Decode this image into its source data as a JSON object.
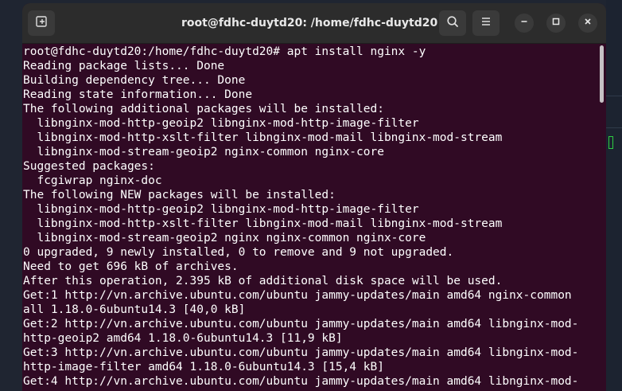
{
  "window": {
    "title": "root@fdhc-duytd20: /home/fdhc-duytd20"
  },
  "icons": {
    "new_tab": "new-tab-icon",
    "search": "search-icon",
    "menu": "hamburger-menu-icon",
    "minimize": "minimize-icon",
    "maximize": "maximize-icon",
    "close": "close-icon"
  },
  "colors": {
    "terminal_bg": "#300a24",
    "text": "#ffffff",
    "titlebar_bg": "#2c2c2c"
  },
  "terminal": {
    "lines": [
      "root@fdhc-duytd20:/home/fdhc-duytd20# apt install nginx -y",
      "Reading package lists... Done",
      "Building dependency tree... Done",
      "Reading state information... Done",
      "The following additional packages will be installed:",
      "  libnginx-mod-http-geoip2 libnginx-mod-http-image-filter",
      "  libnginx-mod-http-xslt-filter libnginx-mod-mail libnginx-mod-stream",
      "  libnginx-mod-stream-geoip2 nginx-common nginx-core",
      "Suggested packages:",
      "  fcgiwrap nginx-doc",
      "The following NEW packages will be installed:",
      "  libnginx-mod-http-geoip2 libnginx-mod-http-image-filter",
      "  libnginx-mod-http-xslt-filter libnginx-mod-mail libnginx-mod-stream",
      "  libnginx-mod-stream-geoip2 nginx nginx-common nginx-core",
      "0 upgraded, 9 newly installed, 0 to remove and 9 not upgraded.",
      "Need to get 696 kB of archives.",
      "After this operation, 2.395 kB of additional disk space will be used.",
      "Get:1 http://vn.archive.ubuntu.com/ubuntu jammy-updates/main amd64 nginx-common",
      "all 1.18.0-6ubuntu14.3 [40,0 kB]",
      "Get:2 http://vn.archive.ubuntu.com/ubuntu jammy-updates/main amd64 libnginx-mod-",
      "http-geoip2 amd64 1.18.0-6ubuntu14.3 [11,9 kB]",
      "Get:3 http://vn.archive.ubuntu.com/ubuntu jammy-updates/main amd64 libnginx-mod-",
      "http-image-filter amd64 1.18.0-6ubuntu14.3 [15,4 kB]",
      "Get:4 http://vn.archive.ubuntu.com/ubuntu jammy-updates/main amd64 libnginx-mod-"
    ]
  }
}
